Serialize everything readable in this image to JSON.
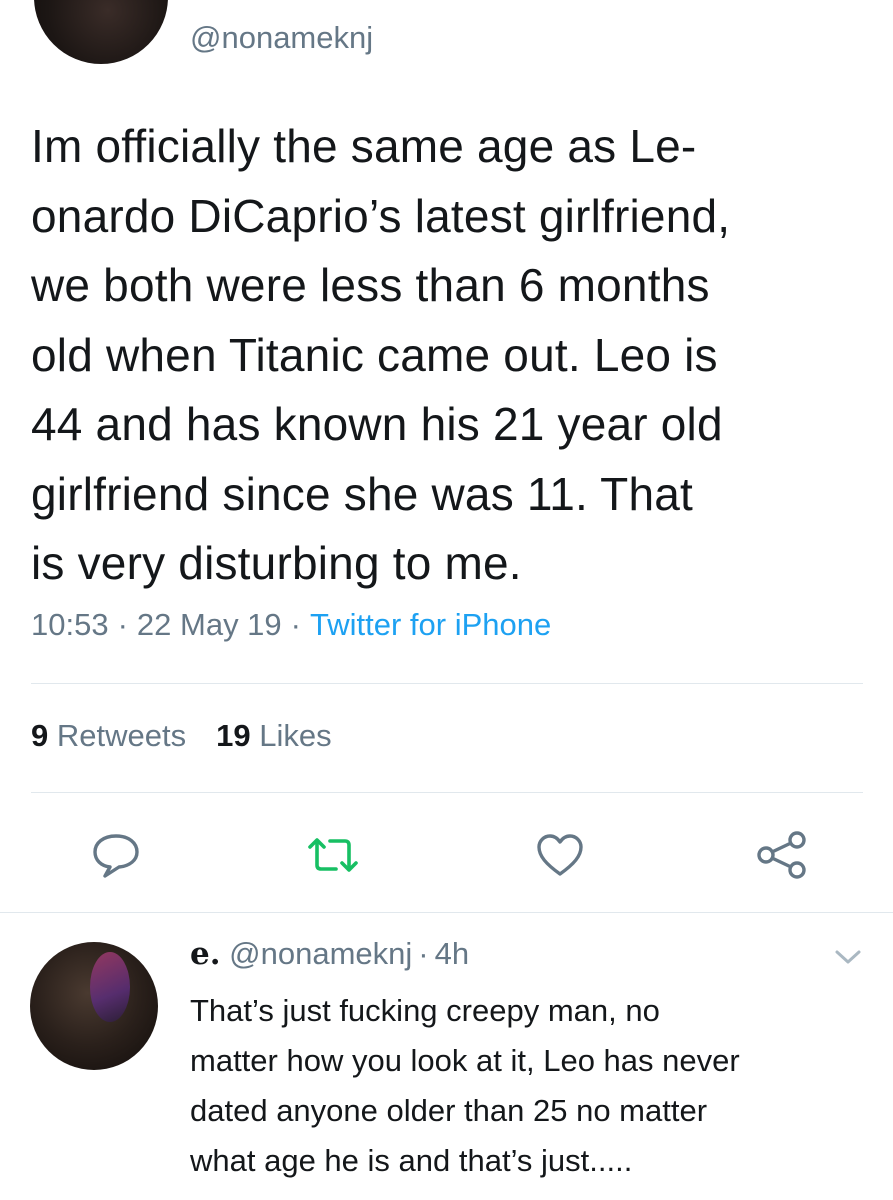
{
  "tweet": {
    "handle": "@nonameknj",
    "text": "Im officially the same age as Le-\nonardo DiCaprio’s latest girlfriend,\nwe both were less than 6 months\nold when Titanic came out. Leo is\n44 and has known his 21 year old\ngirlfriend since she was 11. That\nis very disturbing to me.",
    "time": "10:53",
    "date": "22 May 19",
    "source": "Twitter for iPhone",
    "separator": "·"
  },
  "stats": {
    "retweets_count": "9",
    "retweets_label": "Retweets",
    "likes_count": "19",
    "likes_label": "Likes"
  },
  "actions": {
    "reply_icon": "speech-bubble-icon",
    "retweet_icon": "retweet-icon",
    "like_icon": "heart-icon",
    "share_icon": "share-icon",
    "retweet_color": "#17bf63",
    "icon_color": "#657786"
  },
  "reply": {
    "name": "e.",
    "handle": "@nonameknj",
    "separator": "·",
    "age": "4h",
    "text": "That’s just fucking creepy man, no\nmatter how you look at it, Leo has never\ndated anyone older than 25 no matter\nwhat age he is and that’s just....."
  },
  "colors": {
    "text": "#14171a",
    "secondary": "#657786",
    "link": "#1da1f2",
    "divider": "#e1e8ed"
  }
}
